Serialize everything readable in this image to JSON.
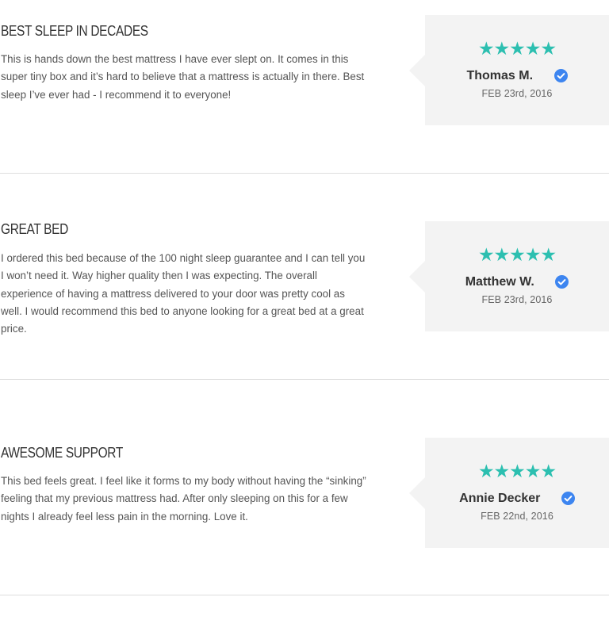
{
  "colors": {
    "star": "#2cbfb0",
    "verified_badge": "#3d85f0",
    "meta_background": "#f3f3f3",
    "divider": "#dedede"
  },
  "reviews": [
    {
      "title": "BEST SLEEP IN DECADES",
      "body": "This is hands down the best mattress I have ever slept on. It comes in this super tiny box and it’s hard to believe that a mattress is actually in there. Best sleep I’ve ever had - I recommend it to everyone!",
      "rating": 5,
      "stars": "★★★★★",
      "reviewer": "Thomas M.",
      "date": "FEB 23rd, 2016",
      "verified": true
    },
    {
      "title": "GREAT BED",
      "body": "I ordered this bed because of the 100 night sleep guarantee and I can tell you I won’t need it. Way higher quality then I was expecting. The overall experience of having a mattress delivered to your door was pretty cool as well. I would recommend this bed to anyone looking for a great bed at a great price.",
      "rating": 5,
      "stars": "★★★★★",
      "reviewer": "Matthew W.",
      "date": "FEB 23rd, 2016",
      "verified": true
    },
    {
      "title": "AWESOME SUPPORT",
      "body": "This bed feels great. I feel like it forms to my body without having the “sinking” feeling that my previous mattress had. After only sleeping on this for a few nights I already feel less pain in the morning. Love it.",
      "rating": 5,
      "stars": "★★★★★",
      "reviewer": "Annie Decker",
      "date": "FEB 22nd, 2016",
      "verified": true
    }
  ]
}
